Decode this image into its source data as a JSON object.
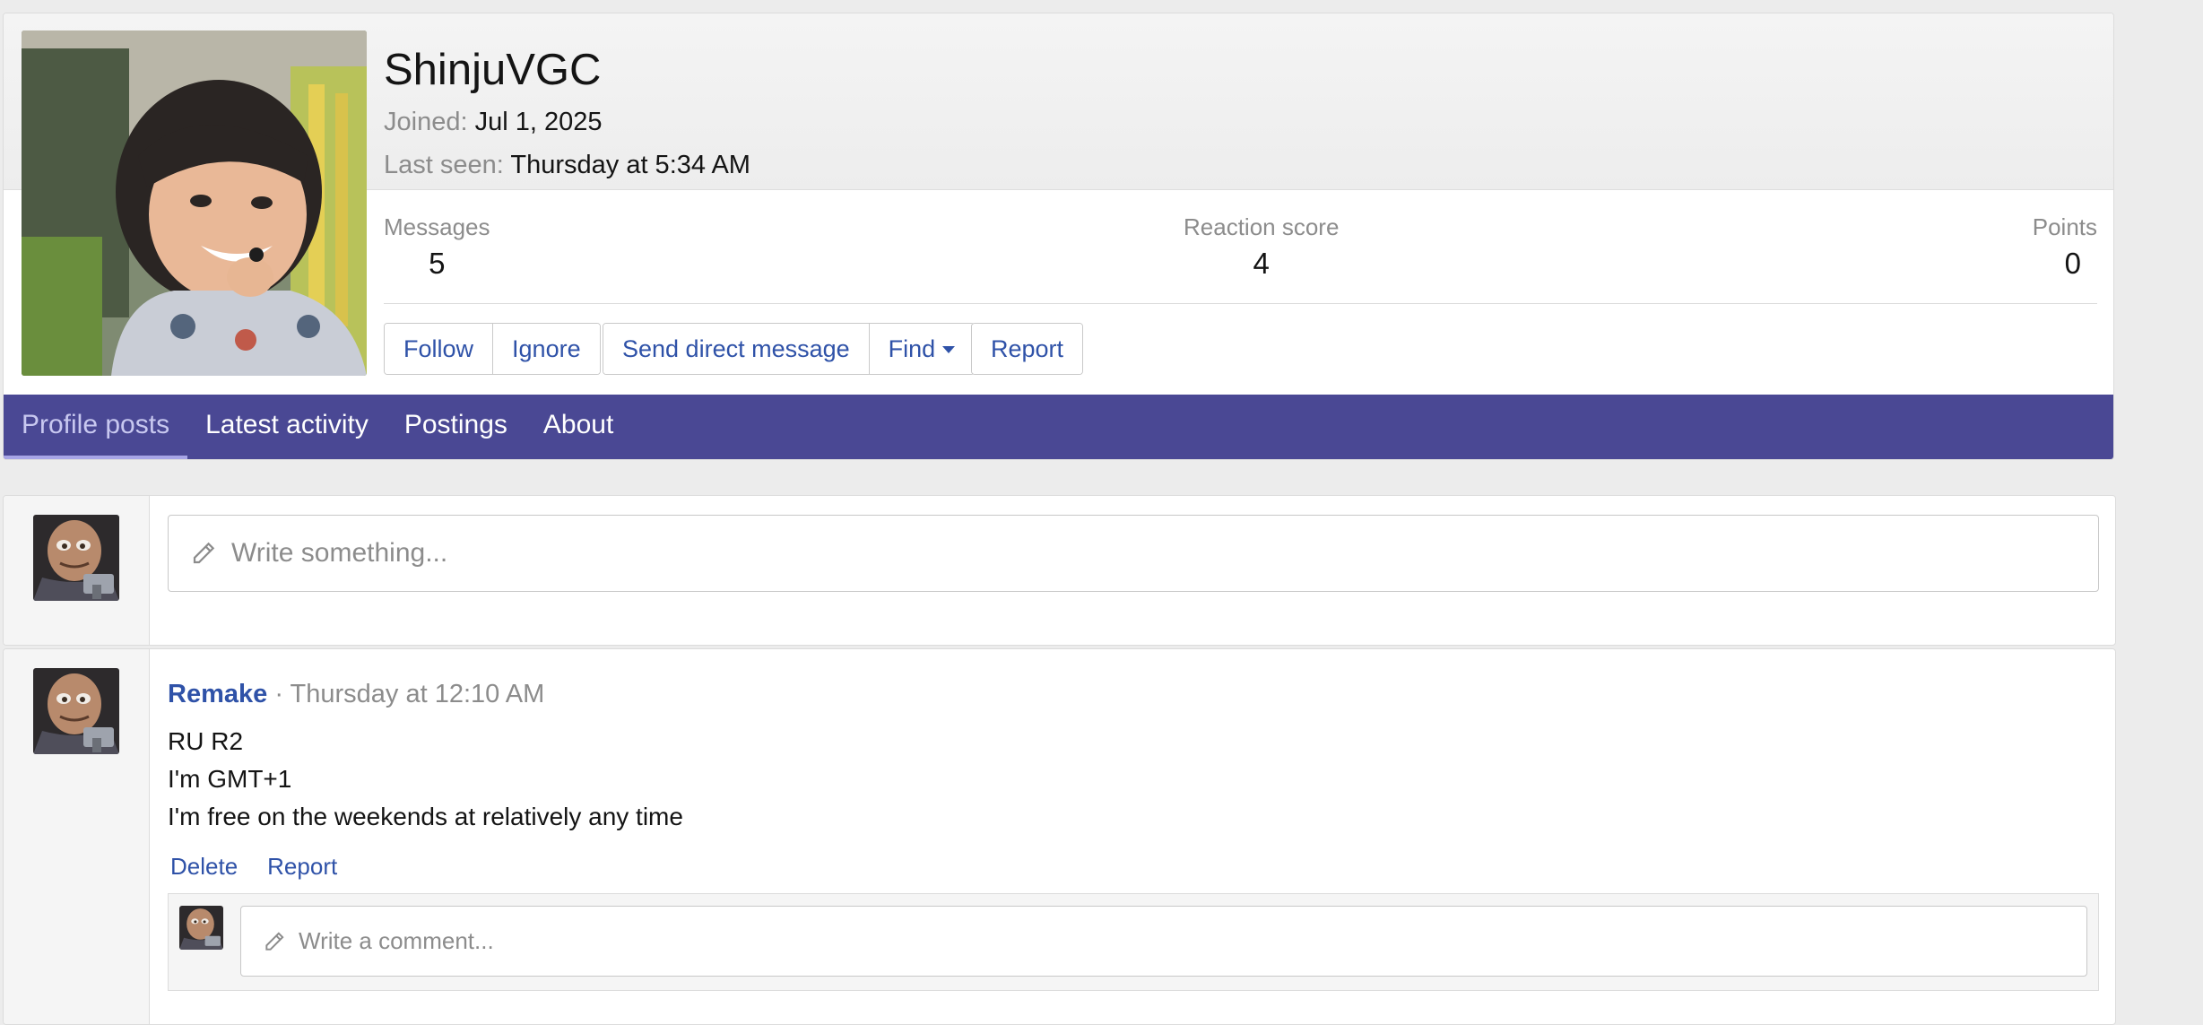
{
  "profile": {
    "username": "ShinjuVGC",
    "joined_label": "Joined:",
    "joined_value": "Jul 1, 2025",
    "last_seen_label": "Last seen:",
    "last_seen_value": "Thursday at 5:34 AM",
    "stats": {
      "messages_label": "Messages",
      "messages_value": "5",
      "reaction_label": "Reaction score",
      "reaction_value": "4",
      "points_label": "Points",
      "points_value": "0"
    },
    "actions": {
      "follow": "Follow",
      "ignore": "Ignore",
      "send_message": "Send direct message",
      "find": "Find",
      "report": "Report"
    }
  },
  "tabs": [
    {
      "label": "Profile posts",
      "active": true
    },
    {
      "label": "Latest activity",
      "active": false
    },
    {
      "label": "Postings",
      "active": false
    },
    {
      "label": "About",
      "active": false
    }
  ],
  "composer": {
    "placeholder": "Write something..."
  },
  "post": {
    "author": "Remake",
    "separator": "·",
    "time": "Thursday at 12:10 AM",
    "lines": [
      "RU R2",
      "I'm GMT+1",
      "I'm free on the weekends at relatively any time"
    ],
    "delete_label": "Delete",
    "report_label": "Report",
    "comment_placeholder": "Write a comment..."
  },
  "colors": {
    "accent": "#4a4894",
    "link": "#2f52a8",
    "muted": "#8c8c8c"
  }
}
